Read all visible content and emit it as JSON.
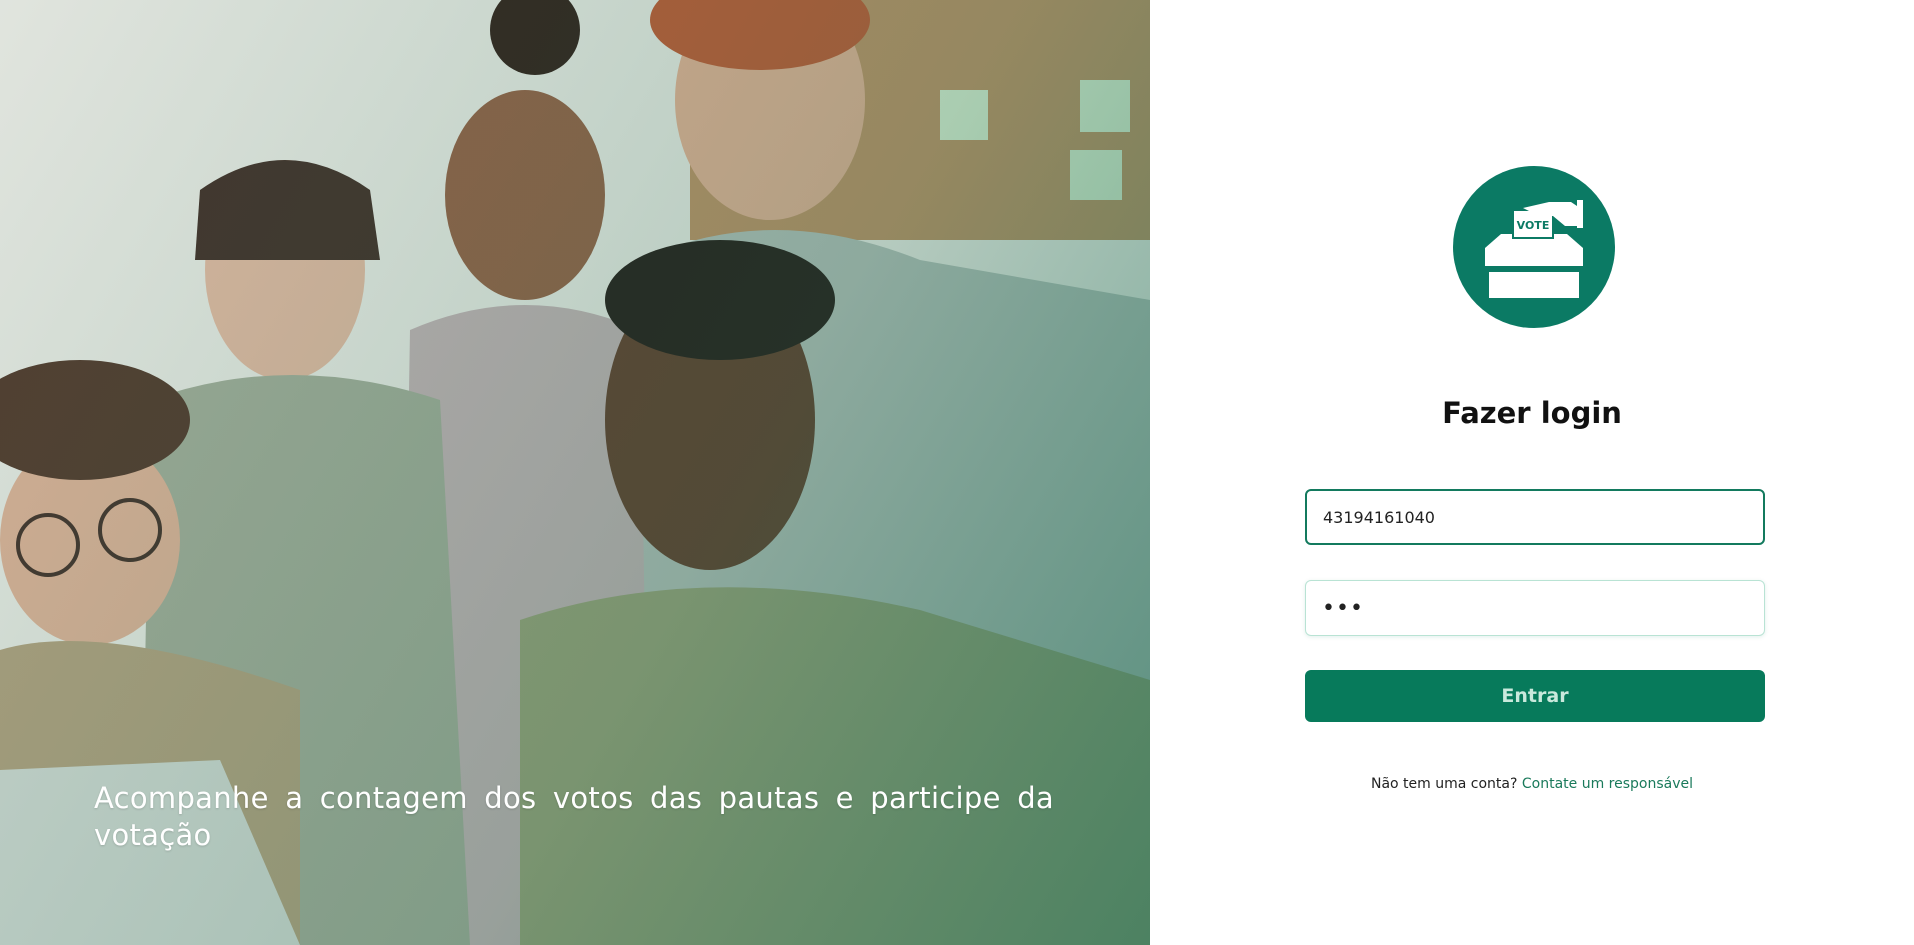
{
  "hero": {
    "image_alt": "Group of smiling people looking at a laptop",
    "caption": "Acompanhe a contagem dos votos das pautas e participe da votação"
  },
  "logo": {
    "icon": "vote-ballot-box-icon",
    "text": "VOTE",
    "color": "#0b7a64"
  },
  "login": {
    "title": "Fazer login",
    "username_value": "43194161040",
    "password_value": "abc",
    "submit_label": "Entrar",
    "signup_prompt": "Não tem uma conta?",
    "signup_link": "Contate um responsável"
  },
  "colors": {
    "accent": "#077a5b",
    "button_text": "#c9e9dc",
    "link": "#1a7a5b"
  }
}
